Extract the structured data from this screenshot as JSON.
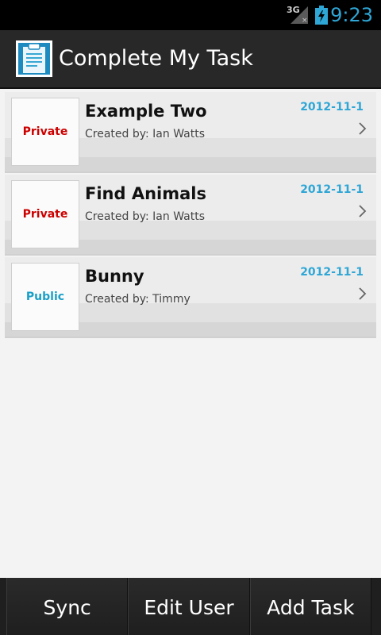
{
  "status_bar": {
    "network": "3G",
    "time": "9:23"
  },
  "action_bar": {
    "title": "Complete My Task",
    "icon": "clipboard-icon"
  },
  "tasks": [
    {
      "visibility": "Private",
      "visibility_color": "#cc0000",
      "title": "Example Two",
      "created_by": "Created by: Ian Watts",
      "date": "2012-11-1"
    },
    {
      "visibility": "Private",
      "visibility_color": "#cc0000",
      "title": "Find Animals",
      "created_by": "Created by: Ian Watts",
      "date": "2012-11-1"
    },
    {
      "visibility": "Public",
      "visibility_color": "#1aa0c8",
      "title": "Bunny",
      "created_by": "Created by: Timmy",
      "date": "2012-11-1"
    }
  ],
  "bottom_bar": {
    "sync": "Sync",
    "edit_user": "Edit User",
    "add_task": "Add Task"
  },
  "colors": {
    "accent": "#2ea6d6",
    "private": "#cc0000",
    "public": "#1aa0c8"
  }
}
